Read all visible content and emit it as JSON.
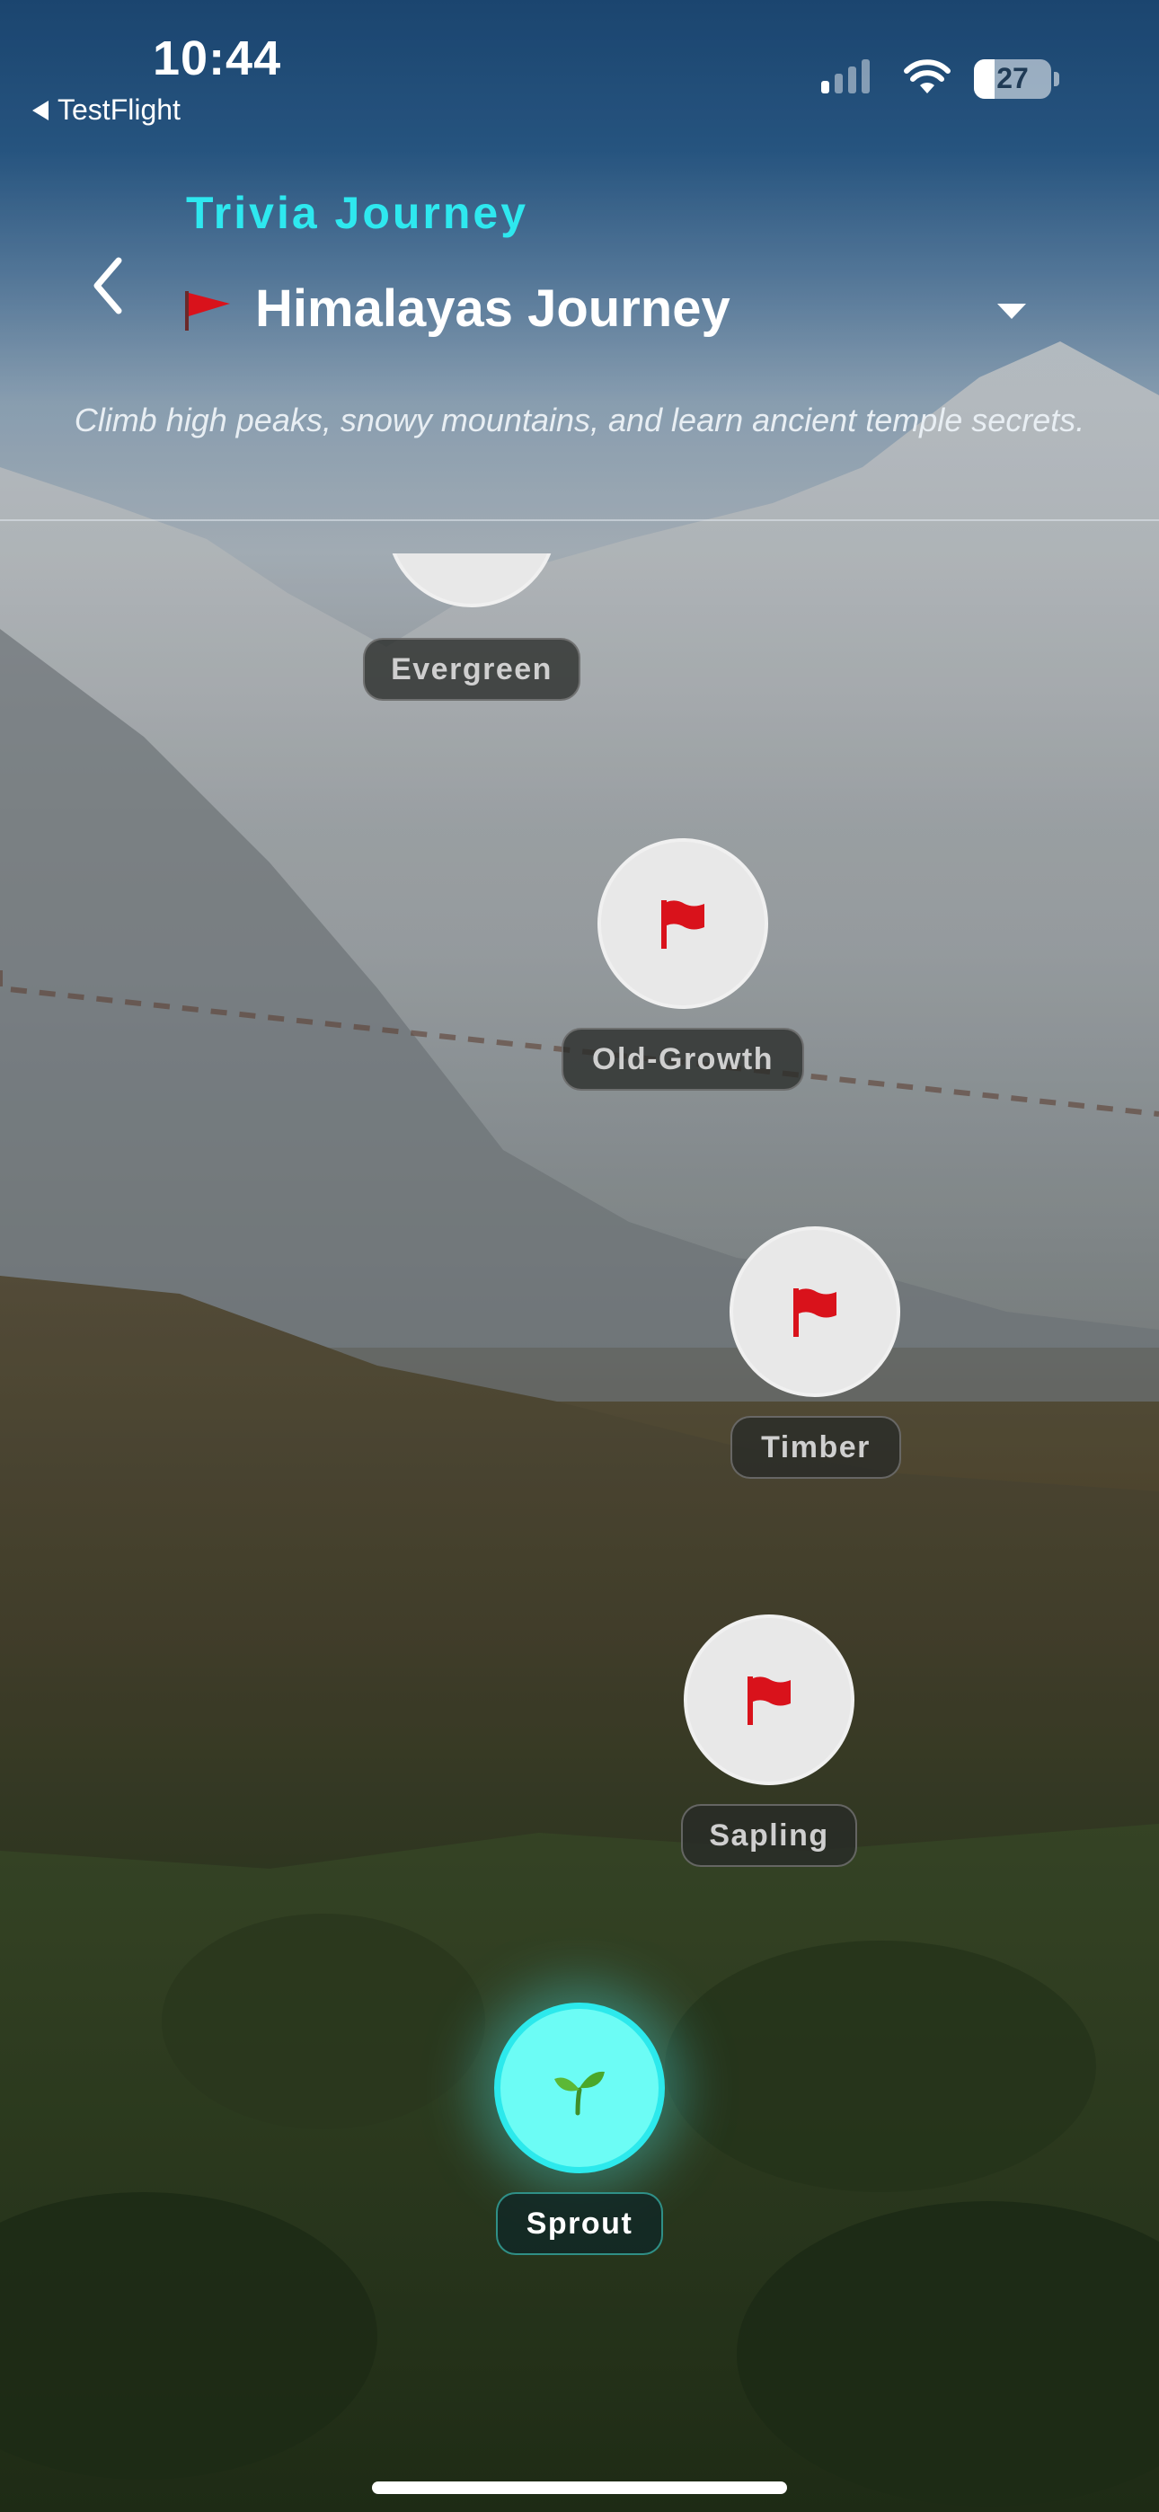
{
  "status_bar": {
    "time": "10:44",
    "back_app": "TestFlight",
    "battery_level": "27"
  },
  "header": {
    "title_label": "Trivia Journey",
    "journey_name": "Himalayas Journey",
    "description": "Climb high peaks, snowy mountains, and learn ancient temple secrets."
  },
  "path": {
    "nodes": [
      {
        "label": "Evergreen",
        "icon": "flag-icon",
        "state": "locked"
      },
      {
        "label": "Old-Growth",
        "icon": "flag-icon",
        "state": "locked"
      },
      {
        "label": "Timber",
        "icon": "flag-icon",
        "state": "locked"
      },
      {
        "label": "Sapling",
        "icon": "flag-icon",
        "state": "locked"
      },
      {
        "label": "Sprout",
        "icon": "seedling-icon",
        "state": "current"
      }
    ]
  },
  "colors": {
    "accent": "#2ee8ef",
    "flag": "#d9121b",
    "node_bg": "#e8e8e8",
    "active_node_bg": "#6cfcf5"
  }
}
